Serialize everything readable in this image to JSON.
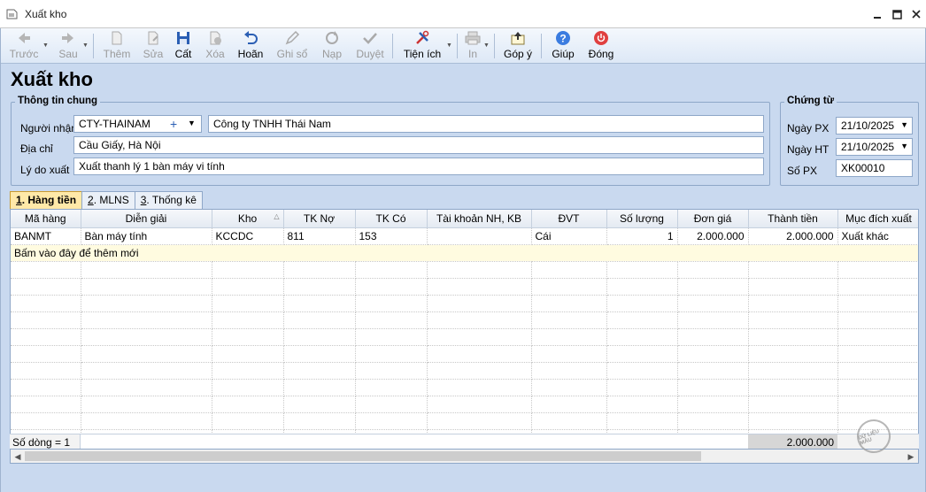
{
  "window": {
    "title": "Xuất kho"
  },
  "toolbar": {
    "prev": "Trước",
    "next": "Sau",
    "add": "Thêm",
    "edit": "Sửa",
    "save": "Cất",
    "delete": "Xóa",
    "undo": "Hoãn",
    "post": "Ghi sổ",
    "reload": "Nạp",
    "approve": "Duyệt",
    "utilities": "Tiện ích",
    "print": "In",
    "feedback": "Góp ý",
    "help": "Giúp",
    "close": "Đóng"
  },
  "heading": "Xuất kho",
  "general": {
    "title": "Thông tin chung",
    "receiver_label": "Người nhận",
    "receiver_code": "CTY-THAINAM",
    "receiver_name": "Công ty TNHH Thái Nam",
    "address_label": "Địa chỉ",
    "address": "Cầu Giấy, Hà Nội",
    "reason_label": "Lý do xuất",
    "reason": "Xuất thanh lý 1 bàn máy vi tính"
  },
  "voucher": {
    "title": "Chứng từ",
    "date_px_label": "Ngày PX",
    "date_px": "21/10/2025",
    "date_ht_label": "Ngày HT",
    "date_ht": "21/10/2025",
    "no_label": "Số PX",
    "no": "XK00010"
  },
  "tabs": [
    {
      "num": "1",
      "label": ". Hàng tiền"
    },
    {
      "num": "2",
      "label": ". MLNS"
    },
    {
      "num": "3",
      "label": ". Thống kê"
    }
  ],
  "grid": {
    "columns": [
      "Mã hàng",
      "Diễn giải",
      "Kho",
      "TK Nợ",
      "TK Có",
      "Tài khoản NH, KB",
      "ĐVT",
      "Số lượng",
      "Đơn giá",
      "Thành tiền",
      "Mục đích xuất"
    ],
    "rows": [
      {
        "ma_hang": "BANMT",
        "dien_giai": "Bàn máy tính",
        "kho": "KCCDC",
        "tk_no": "811",
        "tk_co": "153",
        "tk_nh": "",
        "dvt": "Cái",
        "so_luong": "1",
        "don_gia": "2.000.000",
        "thanh_tien": "2.000.000",
        "muc_dich": "Xuất khác"
      }
    ],
    "new_row_hint": "Bấm vào đây để thêm mới",
    "row_count": "Số dòng = 1",
    "total": "2.000.000"
  },
  "stamp_text": "DỮ LIỆU MẪU",
  "colors": {
    "accent_tab": "#ffe9a8",
    "background": "#c9d9ef",
    "new_row": "#fffbe0"
  }
}
